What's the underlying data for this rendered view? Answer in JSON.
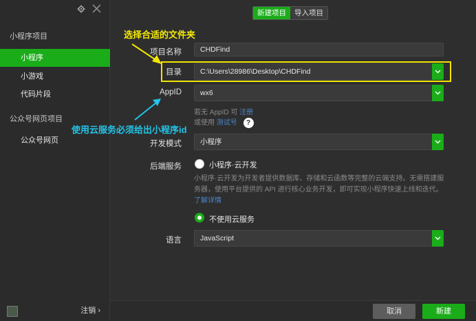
{
  "sidebar": {
    "group1": "小程序项目",
    "items1": [
      "小程序",
      "小游戏",
      "代码片段"
    ],
    "group2": "公众号网页项目",
    "items2": [
      "公众号网页"
    ],
    "logout": "注销 ›"
  },
  "tabs": [
    "新建项目",
    "导入项目"
  ],
  "form": {
    "name_label": "项目名称",
    "name_value": "CHDFind",
    "dir_label": "目录",
    "dir_value": "C:\\Users\\28986\\Desktop\\CHDFind",
    "appid_label": "AppID",
    "appid_value": "wx6",
    "appid_hint1_prefix": "若无 AppID 可",
    "appid_hint1_link": "注册",
    "appid_hint2_prefix": "或使用",
    "appid_hint2_link": "测试号",
    "help_icon": "?",
    "mode_label": "开发模式",
    "mode_value": "小程序",
    "backend_label": "后端服务",
    "cloud_option": "小程序·云开发",
    "cloud_desc": "小程序·云开发为开发者提供数据库、存储和云函数等完整的云端支持。无需搭建服务器，使用平台提供的 API 进行核心业务开发，即可实现小程序快速上线和迭代。",
    "cloud_link": "了解详情",
    "no_cloud_option": "不使用云服务",
    "lang_label": "语言",
    "lang_value": "JavaScript"
  },
  "annotations": {
    "choose_folder": "选择合适的文件夹",
    "cloud_note": "使用云服务必须给出小程序id"
  },
  "footer": {
    "cancel": "取消",
    "create": "新建"
  },
  "colors": {
    "accent": "#1aad19",
    "annotation_yellow": "#f2e600",
    "annotation_cyan": "#23c4e8"
  }
}
